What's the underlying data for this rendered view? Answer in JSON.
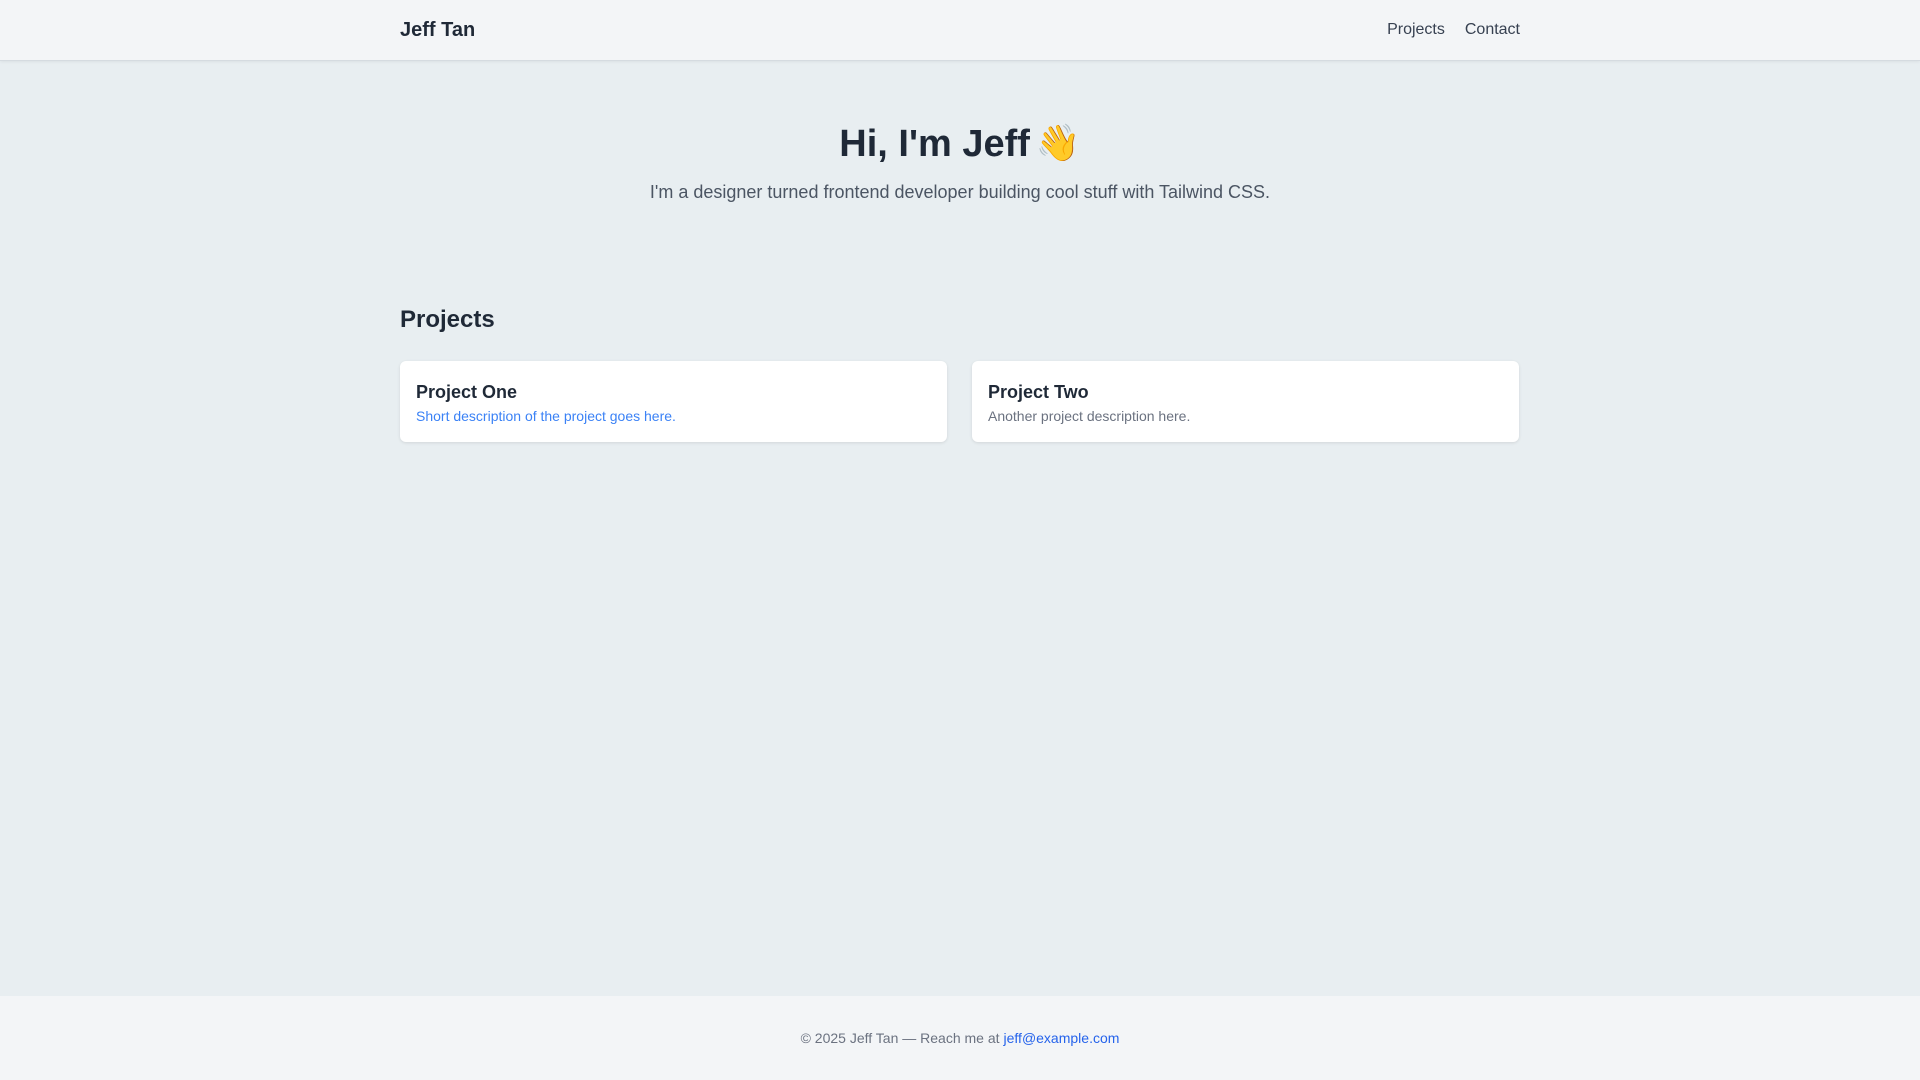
{
  "header": {
    "brand": "Jeff Tan",
    "nav": [
      "Projects",
      "Contact"
    ]
  },
  "hero": {
    "title": "Hi, I'm Jeff",
    "wave_icon": "👋",
    "subtitle": "I'm a designer turned frontend developer building cool stuff with Tailwind CSS."
  },
  "projects": {
    "heading": "Projects",
    "items": [
      {
        "title": "Project One",
        "description": "Short description of the project goes here."
      },
      {
        "title": "Project Two",
        "description": "Another project description here."
      }
    ]
  },
  "footer": {
    "text": "© 2025 Jeff Tan — Reach me at",
    "email": "jeff@example.com"
  },
  "colors": {
    "background": "#e8eef1",
    "header_footer_bg": "#f3f5f7",
    "link_blue": "#3b82f6",
    "footer_link": "#2563eb"
  }
}
